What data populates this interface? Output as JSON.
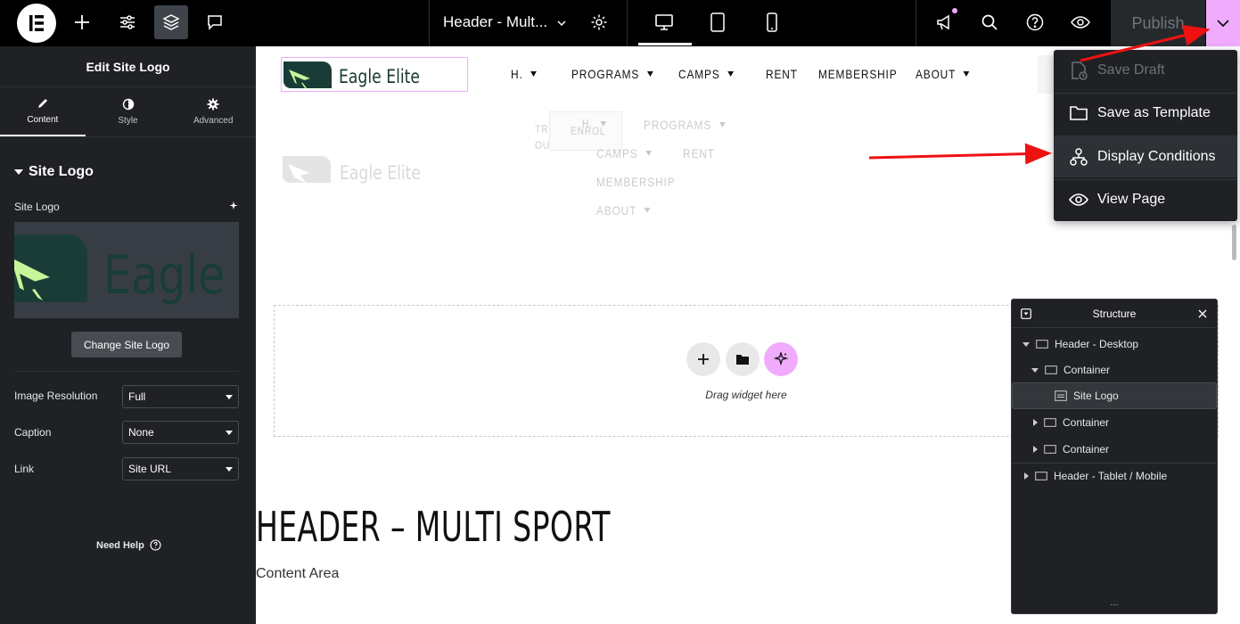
{
  "topbar": {
    "doc_title": "Header - Mult...",
    "publish_label": "Publish"
  },
  "panel": {
    "title": "Edit Site Logo",
    "tabs": [
      {
        "label": "Content"
      },
      {
        "label": "Style"
      },
      {
        "label": "Advanced"
      }
    ],
    "section_title": "Site Logo",
    "site_logo_label": "Site Logo",
    "change_logo_label": "Change Site Logo",
    "preview_text": "Eagle E",
    "fields": [
      {
        "label": "Image Resolution",
        "value": "Full"
      },
      {
        "label": "Caption",
        "value": "None"
      },
      {
        "label": "Link",
        "value": "Site URL"
      }
    ],
    "need_help": "Need Help"
  },
  "canvas": {
    "brand": "Eagle Elite",
    "nav": [
      {
        "label": "H.",
        "has_caret": true
      },
      {
        "label": "PROGRAMS",
        "has_caret": true
      },
      {
        "label": "CAMPS",
        "has_caret": true
      },
      {
        "label": "RENT",
        "has_caret": false
      },
      {
        "label": "MEMBERSHIP",
        "has_caret": false
      },
      {
        "label": "ABOUT",
        "has_caret": true
      }
    ],
    "ghost": {
      "brand": "Eagle Elite",
      "try_line1": "TRY",
      "try_line2": "OUT",
      "enrol": "ENROL",
      "h": "H.",
      "programs": "PROGRAMS",
      "camps": "CAMPS",
      "rent": "RENT",
      "membership": "MEMBERSHIP",
      "about": "ABOUT"
    },
    "drop_text": "Drag widget here",
    "page_heading": "HEADER – MULTI SPORT",
    "content_area": "Content Area"
  },
  "menu": {
    "items": [
      {
        "label": "Save Draft",
        "icon": "save-draft-icon",
        "disabled": true
      },
      {
        "label": "Save as Template",
        "icon": "folder-icon",
        "disabled": false
      },
      {
        "label": "Display Conditions",
        "icon": "display-conditions-icon",
        "disabled": false
      },
      {
        "label": "View Page",
        "icon": "eye-icon",
        "disabled": false
      }
    ]
  },
  "structure": {
    "title": "Structure",
    "rows": [
      {
        "label": "Header - Desktop"
      },
      {
        "label": "Container"
      },
      {
        "label": "Site Logo"
      },
      {
        "label": "Container"
      },
      {
        "label": "Container"
      },
      {
        "label": "Header - Tablet / Mobile"
      }
    ],
    "footer": "..."
  },
  "colors": {
    "accent_pink": "#f0abfc",
    "panel_bg": "#1f2124",
    "topbar_bg": "#000000",
    "brand_green": "#183a33",
    "logo_lime": "#c6f59a",
    "annotation_red": "#ee1111"
  }
}
